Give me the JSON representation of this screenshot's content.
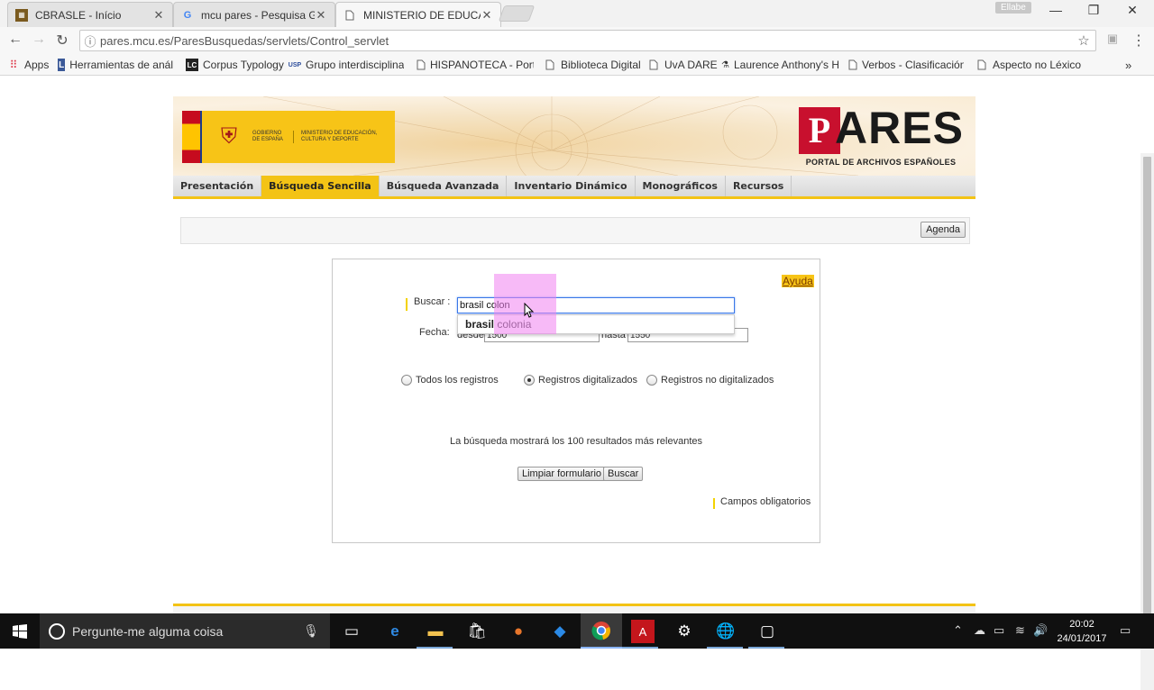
{
  "tabs": [
    {
      "title": "CBRASLE - Início",
      "icon": "cbrasle-favicon"
    },
    {
      "title": "mcu pares - Pesquisa Go",
      "icon": "google-favicon"
    },
    {
      "title": "MINISTERIO DE EDUCAC",
      "icon": "page-favicon"
    }
  ],
  "user_chip": "Ellabe",
  "address": {
    "url": "pares.mcu.es/ParesBusquedas/servlets/Control_servlet"
  },
  "bookmarks": [
    {
      "label": "Apps",
      "icon": "apps-grid-icon"
    },
    {
      "label": "Herramientas de anál",
      "icon": "l-icon"
    },
    {
      "label": "Corpus Typology",
      "icon": "lc-icon"
    },
    {
      "label": "Grupo interdisciplinar",
      "icon": "usp-icon"
    },
    {
      "label": "HISPANOTECA - Porta",
      "icon": "page-icon"
    },
    {
      "label": "Biblioteca Digital",
      "icon": "page-icon"
    },
    {
      "label": "UvA DARE",
      "icon": "page-icon"
    },
    {
      "label": "Laurence Anthony's H",
      "icon": "lab-icon"
    },
    {
      "label": "Verbos - Clasificación",
      "icon": "page-icon"
    },
    {
      "label": "Aspecto no Léxico",
      "icon": "page-icon"
    }
  ],
  "banner": {
    "gov_text": "GOBIERNO DE ESPAÑA",
    "ministry_text": "MINISTERIO DE EDUCACIÓN, CULTURA Y DEPORTE",
    "pares_word": "ARES",
    "pares_mark": "P",
    "pares_subtitle": "PORTAL DE ARCHIVOS ESPAÑOLES"
  },
  "menu": [
    "Presentación",
    "Búsqueda Sencilla",
    "Búsqueda Avanzada",
    "Inventario Dinámico",
    "Monográficos",
    "Recursos"
  ],
  "menu_active": "Búsqueda Sencilla",
  "agenda_label": "Agenda",
  "form": {
    "help_link": "Ayuda",
    "buscar_label": "Buscar :",
    "buscar_value": "brasil colon",
    "suggestion_bold": "brasil",
    "suggestion_rest": " colonia",
    "fecha_label": "Fecha:",
    "desde_label": "desde",
    "desde_value": "1500",
    "hasta_label": "hasta",
    "hasta_value": "1550",
    "radios": [
      {
        "label": "Todos los registros",
        "checked": false
      },
      {
        "label": "Registros digitalizados",
        "checked": true
      },
      {
        "label": "Registros no digitalizados",
        "checked": false
      }
    ],
    "note": "La búsqueda mostrará los 100 resultados más relevantes",
    "clear_button": "Limpiar formulario",
    "search_button": "Buscar",
    "required_note": "Campos obligatorios"
  },
  "taskbar": {
    "search_placeholder": "Pergunte-me alguma coisa",
    "time": "20:02",
    "date": "24/01/2017"
  }
}
